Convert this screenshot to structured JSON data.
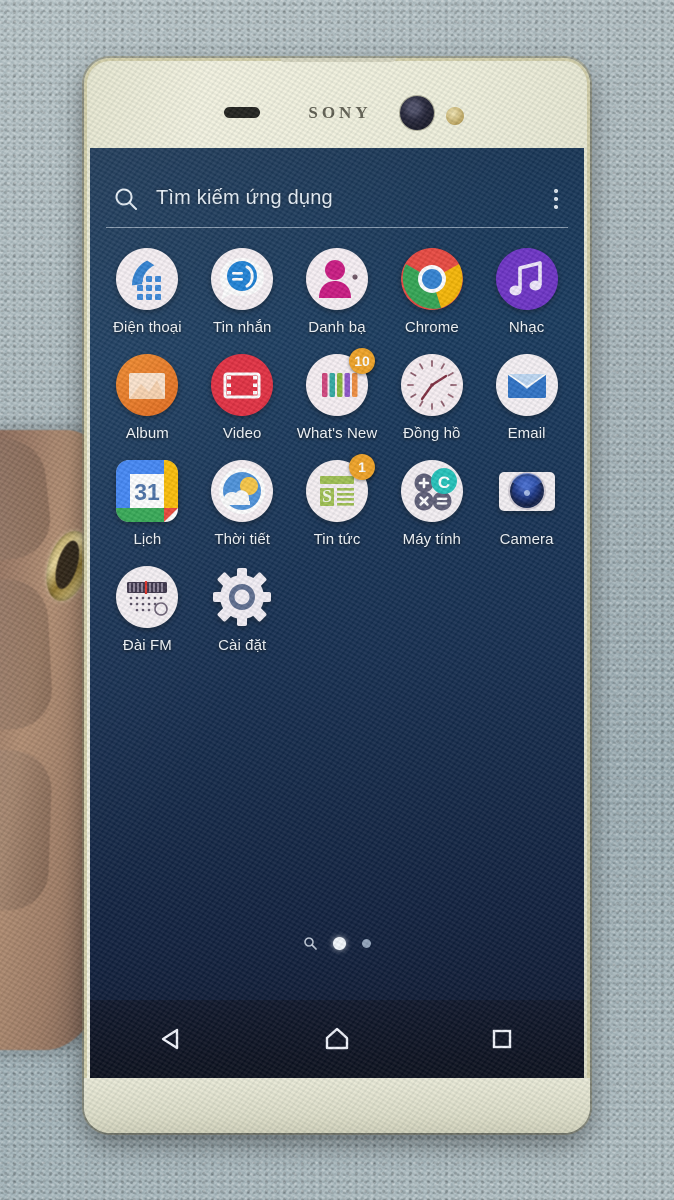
{
  "device": {
    "brand_logo": "SONY",
    "hardware": {
      "earpiece": "earpiece-speaker",
      "front_camera": "front-camera",
      "front_flash": "front-flash"
    }
  },
  "screen": {
    "search": {
      "placeholder": "Tìm kiếm ứng dụng",
      "icon": "search-icon",
      "overflow_icon": "more-vertical-icon"
    },
    "apps": [
      {
        "label": "Điện thoại",
        "icon": "phone-icon",
        "badge": null
      },
      {
        "label": "Tin nhắn",
        "icon": "messaging-icon",
        "badge": null
      },
      {
        "label": "Danh bạ",
        "icon": "contacts-icon",
        "badge": null
      },
      {
        "label": "Chrome",
        "icon": "chrome-icon",
        "badge": null
      },
      {
        "label": "Nhạc",
        "icon": "music-icon",
        "badge": null
      },
      {
        "label": "Album",
        "icon": "album-icon",
        "badge": null
      },
      {
        "label": "Video",
        "icon": "video-icon",
        "badge": null
      },
      {
        "label": "What's New",
        "icon": "whats-new-icon",
        "badge": "10"
      },
      {
        "label": "Đồng hồ",
        "icon": "clock-icon",
        "badge": null
      },
      {
        "label": "Email",
        "icon": "email-icon",
        "badge": null
      },
      {
        "label": "Lịch",
        "icon": "calendar-icon",
        "badge": null,
        "icon_text": "31"
      },
      {
        "label": "Thời tiết",
        "icon": "weather-icon",
        "badge": null
      },
      {
        "label": "Tin tức",
        "icon": "news-icon",
        "badge": "1",
        "icon_text": "S"
      },
      {
        "label": "Máy tính",
        "icon": "calculator-icon",
        "badge": null
      },
      {
        "label": "Camera",
        "icon": "camera-icon",
        "badge": null
      },
      {
        "label": "Đài FM",
        "icon": "fm-radio-icon",
        "badge": null
      },
      {
        "label": "Cài đặt",
        "icon": "settings-gear-icon",
        "badge": null
      }
    ],
    "page_indicator": {
      "search_glyph": "search-icon",
      "pages": 2,
      "active_page": 1
    },
    "navbar": [
      {
        "name": "back-button",
        "icon": "back-triangle-icon"
      },
      {
        "name": "home-button",
        "icon": "home-icon"
      },
      {
        "name": "recents-button",
        "icon": "recents-square-icon"
      }
    ]
  },
  "colors": {
    "screen_bg_top": "#15365a",
    "screen_bg_bottom": "#0a1228",
    "badge": "#efa021",
    "bezel": "#eeeeda",
    "label_text": "#f2f6fa"
  }
}
